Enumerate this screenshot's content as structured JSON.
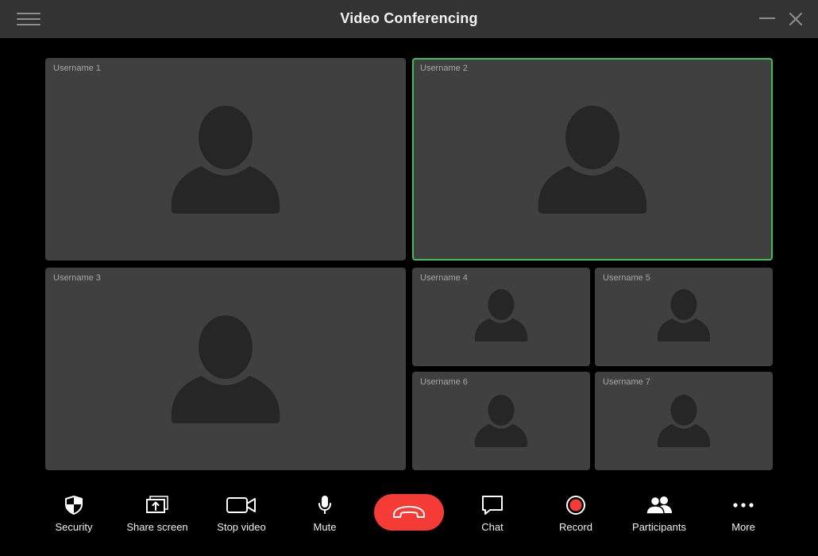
{
  "window": {
    "title": "Video Conferencing",
    "icons": {
      "menu": "hamburger-menu-icon",
      "minimize": "minimize-icon",
      "close": "close-icon"
    }
  },
  "participants": [
    {
      "username": "Username 1",
      "active": false
    },
    {
      "username": "Username 2",
      "active": true
    },
    {
      "username": "Username 3",
      "active": false
    },
    {
      "username": "Username 4",
      "active": false
    },
    {
      "username": "Username 5",
      "active": false
    },
    {
      "username": "Username 6",
      "active": false
    },
    {
      "username": "Username 7",
      "active": false
    }
  ],
  "toolbar": {
    "security": {
      "label": "Security",
      "icon": "shield-icon"
    },
    "share_screen": {
      "label": "Share screen",
      "icon": "share-screen-icon"
    },
    "stop_video": {
      "label": "Stop video",
      "icon": "video-camera-icon"
    },
    "mute": {
      "label": "Mute",
      "icon": "microphone-icon"
    },
    "end_call": {
      "icon": "hang-up-phone-icon"
    },
    "chat": {
      "label": "Chat",
      "icon": "chat-bubble-icon"
    },
    "record": {
      "label": "Record",
      "icon": "record-icon"
    },
    "participants": {
      "label": "Participants",
      "icon": "participants-icon"
    },
    "more": {
      "label": "More",
      "icon": "more-dots-icon"
    }
  },
  "colors": {
    "titlebar": "#333333",
    "background": "#000000",
    "tile": "#404040",
    "avatar": "#262626",
    "active_speaker_border": "#3fbf58",
    "end_call": "#f53b35",
    "record": "#f53b35"
  }
}
